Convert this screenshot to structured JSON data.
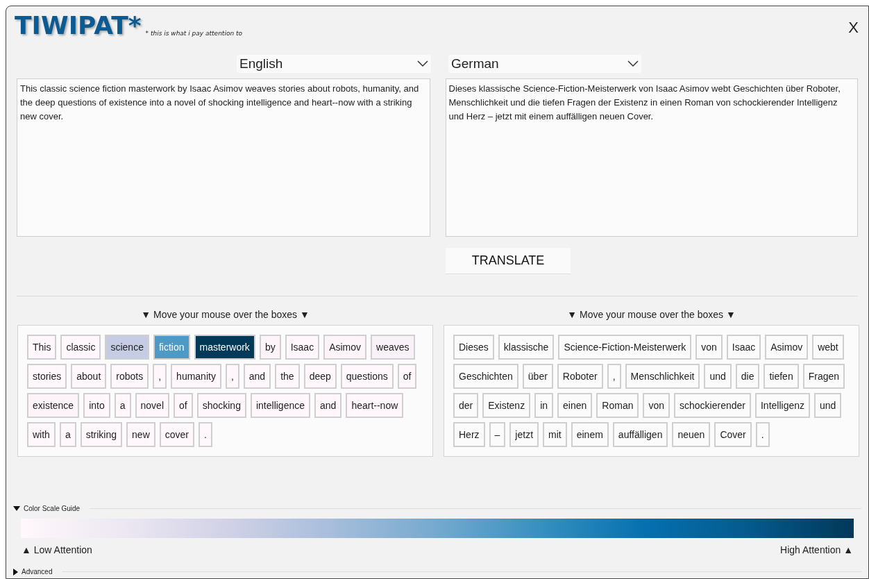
{
  "logo": "TIWIPAT*",
  "tagline": "* this is what i pay attention to",
  "close": "X",
  "source_language": {
    "value": "English"
  },
  "target_language": {
    "value": "German"
  },
  "source_text": "This classic science fiction masterwork by Isaac Asimov weaves stories about robots, humanity, and the deep questions of existence into a novel of shocking intelligence and heart--now with a striking new cover.",
  "target_text": "Dieses klassische Science-Fiction-Meisterwerk von Isaac Asimov webt Geschichten über Roboter, Menschlichkeit und die tiefen Fragen der Existenz in einen Roman von schockierender Intelligenz und Herz – jetzt mit einem auffälligen neuen Cover.",
  "translate_button": "TRANSLATE",
  "source_tokens": {
    "heading": "▼ Move your mouse over the boxes ▼",
    "tokens": [
      {
        "text": "This",
        "color": "#fff7fb"
      },
      {
        "text": "classic",
        "color": "#fff7fb"
      },
      {
        "text": "science",
        "color": "#c5cce3"
      },
      {
        "text": "fiction",
        "color": "#4e9ac6"
      },
      {
        "text": "masterwork",
        "color": "#023858"
      },
      {
        "text": "by",
        "color": "#fdf4f9"
      },
      {
        "text": "Isaac",
        "color": "#fff7fb"
      },
      {
        "text": "Asimov",
        "color": "#fdf4f9"
      },
      {
        "text": "weaves",
        "color": "#f8f1f7"
      },
      {
        "text": "stories",
        "color": "#fff7fb"
      },
      {
        "text": "about",
        "color": "#fff7fb"
      },
      {
        "text": "robots",
        "color": "#fff7fb"
      },
      {
        "text": ",",
        "color": "#fff7fb"
      },
      {
        "text": "humanity",
        "color": "#fff7fb"
      },
      {
        "text": ",",
        "color": "#fff7fb"
      },
      {
        "text": "and",
        "color": "#fff7fb"
      },
      {
        "text": "the",
        "color": "#fff7fb"
      },
      {
        "text": "deep",
        "color": "#fff7fb"
      },
      {
        "text": "questions",
        "color": "#fff7fb"
      },
      {
        "text": "of",
        "color": "#fff7fb"
      },
      {
        "text": "existence",
        "color": "#fdf4f9"
      },
      {
        "text": "into",
        "color": "#fff7fb"
      },
      {
        "text": "a",
        "color": "#fff7fb"
      },
      {
        "text": "novel",
        "color": "#fff7fb"
      },
      {
        "text": "of",
        "color": "#fff7fb"
      },
      {
        "text": "shocking",
        "color": "#fff7fb"
      },
      {
        "text": "intelligence",
        "color": "#fff7fb"
      },
      {
        "text": "and",
        "color": "#fff7fb"
      },
      {
        "text": "heart--now",
        "color": "#fff7fb"
      },
      {
        "text": "with",
        "color": "#fff7fb"
      },
      {
        "text": "a",
        "color": "#fff7fb"
      },
      {
        "text": "striking",
        "color": "#fff7fb"
      },
      {
        "text": "new",
        "color": "#fff7fb"
      },
      {
        "text": "cover",
        "color": "#fff7fb"
      },
      {
        "text": ".",
        "color": "#fff7fb"
      }
    ]
  },
  "target_tokens": {
    "heading": "▼ Move your mouse over the boxes ▼",
    "tokens": [
      {
        "text": "Dieses"
      },
      {
        "text": "klassische"
      },
      {
        "text": "Science-Fiction-Meisterwerk"
      },
      {
        "text": "von"
      },
      {
        "text": "Isaac"
      },
      {
        "text": "Asimov"
      },
      {
        "text": "webt"
      },
      {
        "text": "Geschichten"
      },
      {
        "text": "über"
      },
      {
        "text": "Roboter"
      },
      {
        "text": ","
      },
      {
        "text": "Menschlichkeit"
      },
      {
        "text": "und"
      },
      {
        "text": "die"
      },
      {
        "text": "tiefen"
      },
      {
        "text": "Fragen"
      },
      {
        "text": "der"
      },
      {
        "text": "Existenz"
      },
      {
        "text": "in"
      },
      {
        "text": "einen"
      },
      {
        "text": "Roman"
      },
      {
        "text": "von"
      },
      {
        "text": "schockierender"
      },
      {
        "text": "Intelligenz"
      },
      {
        "text": "und"
      },
      {
        "text": "Herz"
      },
      {
        "text": "–"
      },
      {
        "text": "jetzt"
      },
      {
        "text": "mit"
      },
      {
        "text": "einem"
      },
      {
        "text": "auffälligen"
      },
      {
        "text": "neuen"
      },
      {
        "text": "Cover"
      },
      {
        "text": "."
      }
    ]
  },
  "color_scale_guide": {
    "label": "Color Scale Guide",
    "expanded": true,
    "low_label": "▲ Low Attention",
    "high_label": "High Attention ▲"
  },
  "advanced": {
    "label": "Advanced",
    "expanded": false
  }
}
